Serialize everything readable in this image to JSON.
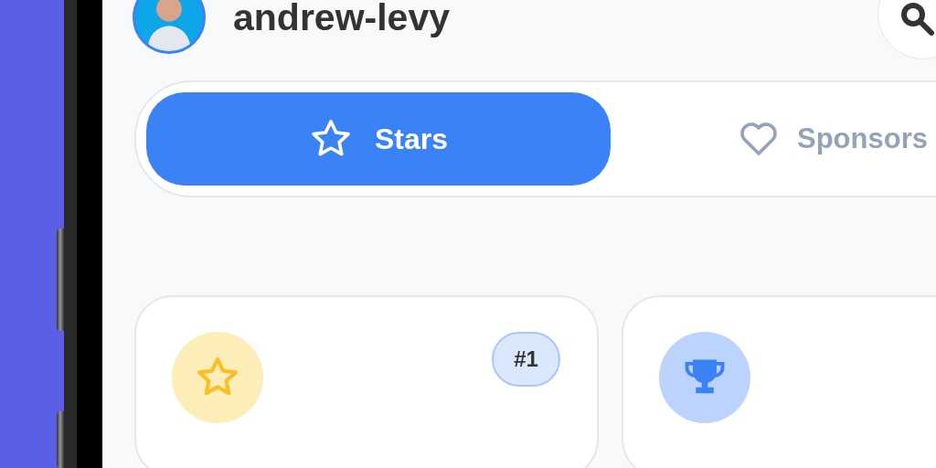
{
  "header": {
    "username": "andrew-levy"
  },
  "tabs": [
    {
      "label": "Stars",
      "kind": "star",
      "selected": true
    },
    {
      "label": "Sponsors",
      "kind": "heart",
      "selected": false
    }
  ],
  "cards": [
    {
      "kind": "star",
      "badge": "#1"
    },
    {
      "kind": "trophy"
    }
  ]
}
